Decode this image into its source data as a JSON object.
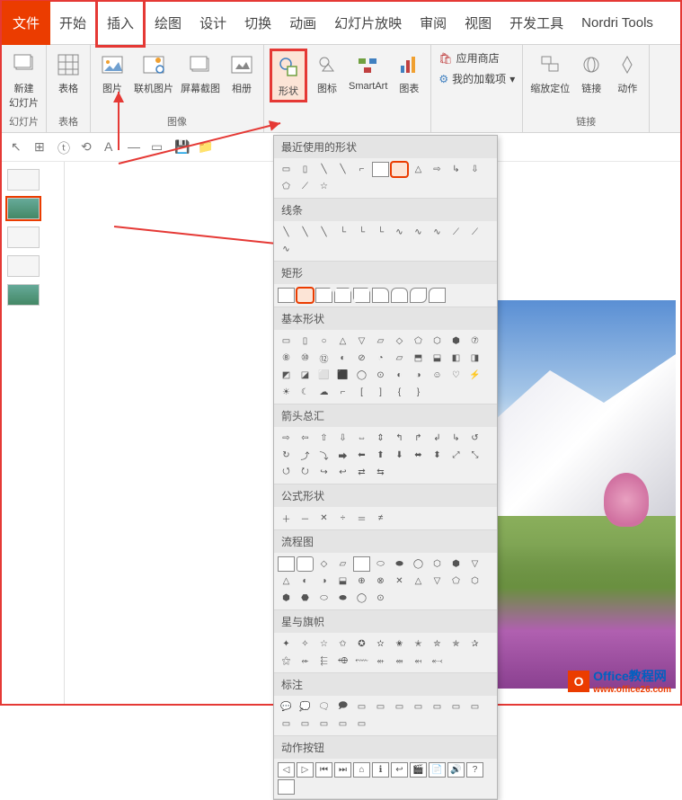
{
  "tabs": {
    "file": "文件",
    "home": "开始",
    "insert": "插入",
    "draw": "绘图",
    "design": "设计",
    "transition": "切换",
    "animation": "动画",
    "slideshow": "幻灯片放映",
    "review": "审阅",
    "view": "视图",
    "developer": "开发工具",
    "nordri": "Nordri Tools"
  },
  "ribbon": {
    "new_slide": "新建\n幻灯片",
    "slides_group": "幻灯片",
    "table": "表格",
    "tables_group": "表格",
    "picture": "图片",
    "online_pic": "联机图片",
    "screenshot": "屏幕截图",
    "album": "相册",
    "images_group": "图像",
    "shapes": "形状",
    "icons": "图标",
    "smartart": "SmartArt",
    "chart": "图表",
    "store": "应用商店",
    "addins": "我的加载项",
    "zoom": "缩放定位",
    "link": "链接",
    "action": "动作",
    "links_group": "链接"
  },
  "shapes_menu": {
    "recent": "最近使用的形状",
    "lines": "线条",
    "rects": "矩形",
    "basic": "基本形状",
    "arrows": "箭头总汇",
    "formula": "公式形状",
    "flowchart": "流程图",
    "stars": "星与旗帜",
    "callouts": "标注",
    "buttons": "动作按钮"
  },
  "watermark": {
    "title": "Office教程网",
    "url": "www.office26.com"
  }
}
